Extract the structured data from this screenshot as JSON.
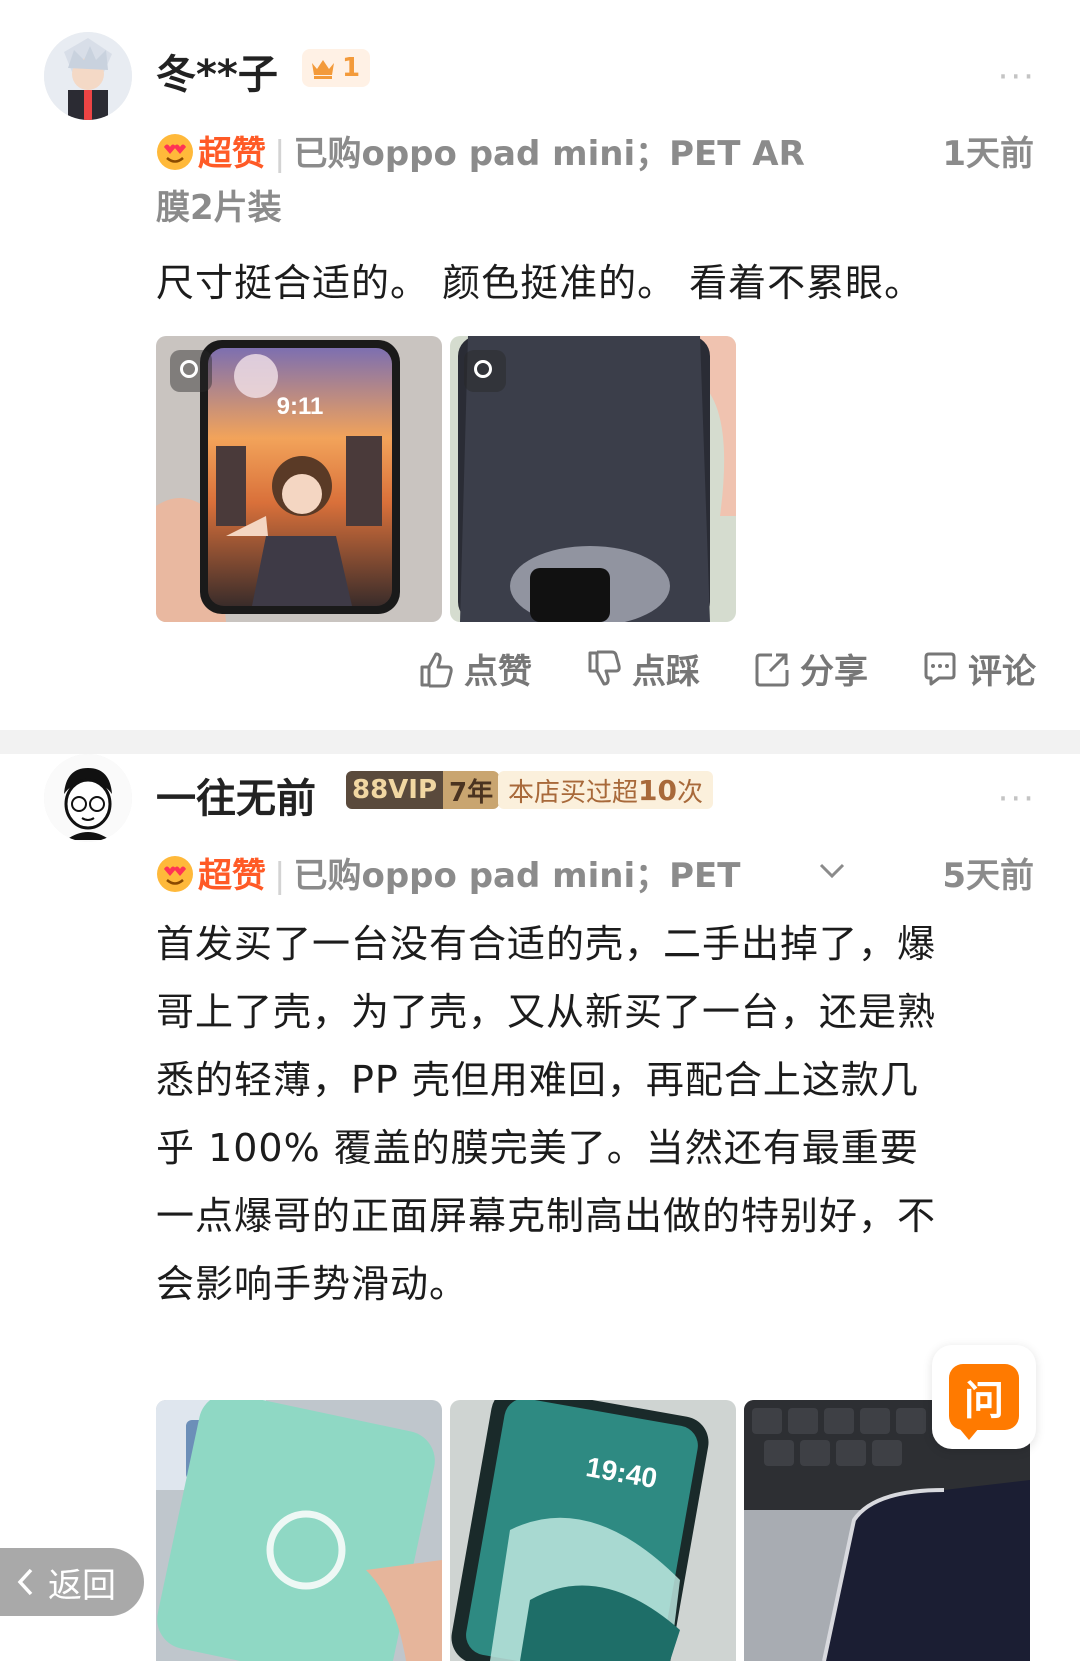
{
  "review1": {
    "username": "冬**子",
    "level": "1",
    "rating_label": "超赞",
    "purchase_line1": "已购oppo pad mini；PET AR",
    "purchase_line2": "膜2片装",
    "time": "1天前",
    "content": "尺寸挺合适的。 颜色挺准的。 看着不累眼。",
    "more": "···",
    "actions": {
      "like": "点赞",
      "dislike": "点踩",
      "share": "分享",
      "comment": "评论"
    }
  },
  "review2": {
    "username": "一往无前",
    "vip_label": "88VIP",
    "vip_years": "7年",
    "shop_badge_prefix": "本店买过超",
    "shop_badge_count": "10",
    "shop_badge_suffix": "次",
    "rating_label": "超赞",
    "purchase": "已购oppo pad mini；PET",
    "time": "5天前",
    "more": "···",
    "content_lines": [
      "首发买了一台没有合适的壳，二手出掉了，爆",
      "哥上了壳，为了壳，又从新买了一台，还是熟",
      "悉的轻薄，PP 壳但用难回，再配合上这款几",
      "乎 100% 覆盖的膜完美了。当然还有最重要",
      "一点爆哥的正面屏幕克制高出做的特别好，不",
      "会影响手势滑动。"
    ],
    "photo2_time": "19:40"
  },
  "photo1_time": "9:11",
  "ask_button": "问",
  "back_button": "返回",
  "colors": {
    "accent": "#ff5a26",
    "orange": "#ff7a00",
    "gray_text": "#8b8b8b"
  }
}
